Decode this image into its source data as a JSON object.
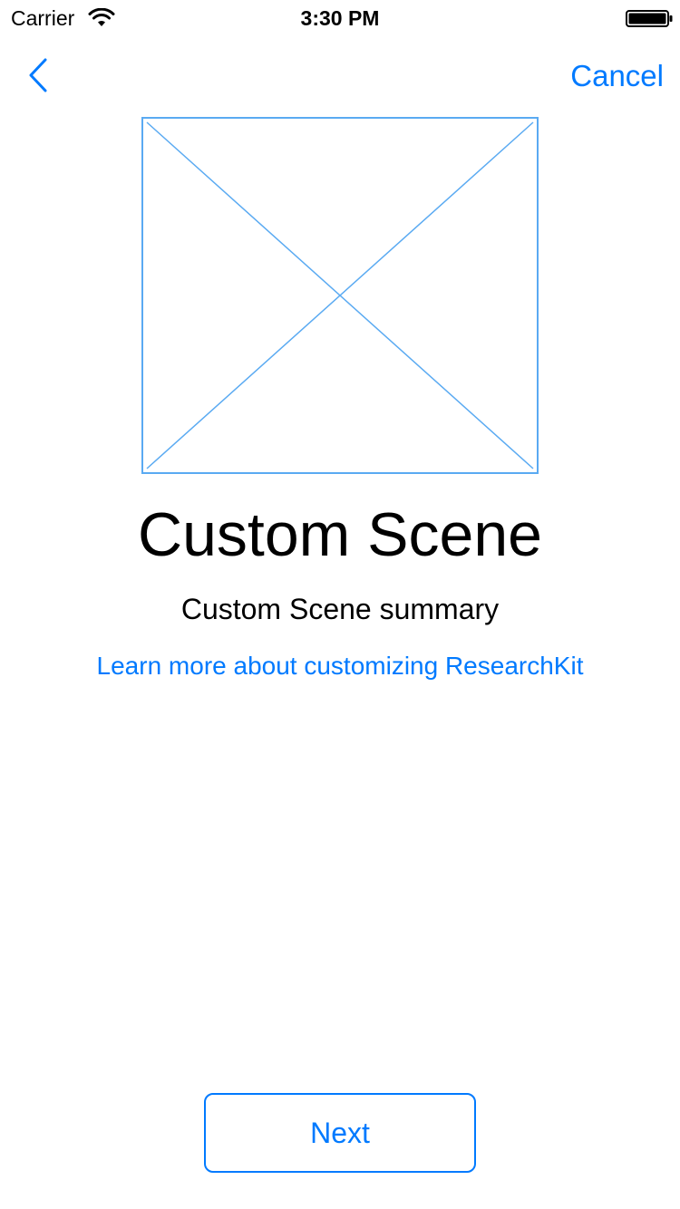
{
  "status_bar": {
    "carrier": "Carrier",
    "time": "3:30 PM",
    "icons": [
      "wifi-icon",
      "battery-icon"
    ]
  },
  "nav": {
    "back_icon": "chevron-left-icon",
    "cancel_label": "Cancel"
  },
  "content": {
    "image_placeholder": "placeholder-image-icon",
    "title": "Custom Scene",
    "summary": "Custom Scene summary",
    "learn_more_label": "Learn more about customizing ResearchKit"
  },
  "footer": {
    "next_label": "Next"
  },
  "colors": {
    "accent": "#007aff",
    "placeholder_stroke": "#5aaaf2",
    "text": "#000000",
    "background": "#ffffff"
  }
}
